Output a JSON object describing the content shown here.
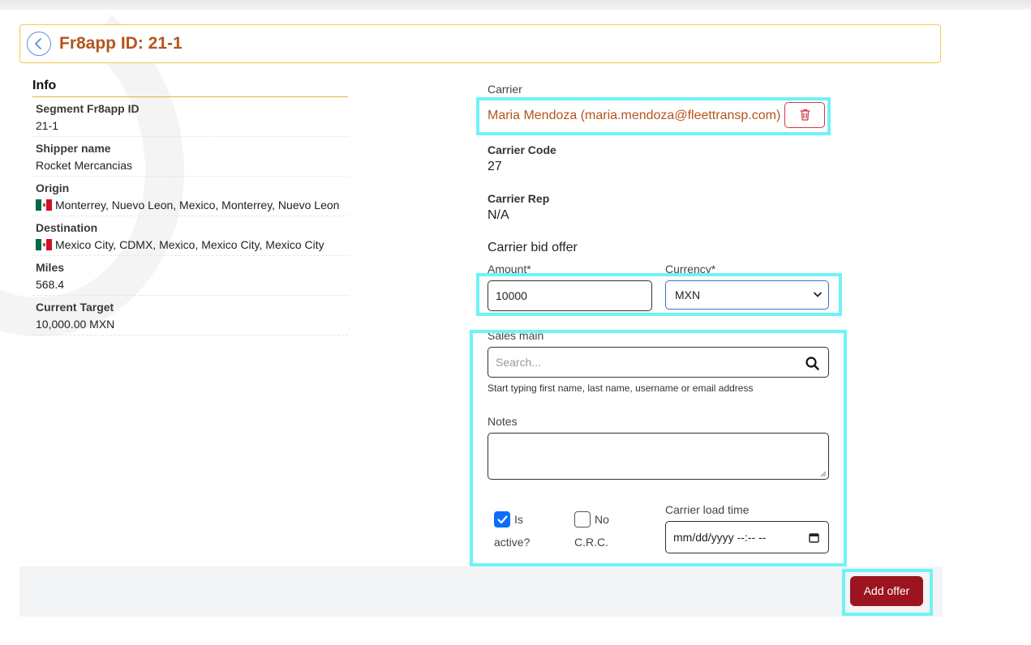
{
  "header": {
    "title": "Fr8app ID: 21-1"
  },
  "info": {
    "title": "Info",
    "rows": [
      {
        "label": "Segment Fr8app ID",
        "value": "21-1"
      },
      {
        "label": "Shipper name",
        "value": "Rocket Mercancias"
      },
      {
        "label": "Origin",
        "value": "Monterrey, Nuevo Leon, Mexico, Monterrey, Nuevo Leon"
      },
      {
        "label": "Destination",
        "value": "Mexico City, CDMX, Mexico, Mexico City, Mexico City"
      },
      {
        "label": "Miles",
        "value": "568.4"
      },
      {
        "label": "Current Target",
        "value": "10,000.00 MXN"
      }
    ]
  },
  "carrier": {
    "label": "Carrier",
    "name": "Maria Mendoza (maria.mendoza@fleettransp.com)",
    "code_label": "Carrier Code",
    "code": "27",
    "rep_label": "Carrier Rep",
    "rep": "N/A"
  },
  "bid": {
    "title": "Carrier bid offer",
    "amount_label": "Amount*",
    "amount_value": "10000",
    "currency_label": "Currency*",
    "currency_value": "MXN"
  },
  "sales": {
    "label": "Sales main",
    "search_placeholder": "Search...",
    "help": "Start typing first name, last name, username or email address"
  },
  "notes": {
    "label": "Notes",
    "value": ""
  },
  "checkboxes": {
    "is_active_line1": "Is",
    "is_active_line2": "active?",
    "no_crc_line1": "No",
    "no_crc_line2": "C.R.C."
  },
  "load_time": {
    "label": "Carrier load time",
    "value": "mm/dd/yyyy --:-- --"
  },
  "footer": {
    "add_offer": "Add offer"
  },
  "colors": {
    "accent": "#b5541c",
    "primary_button": "#9c1420",
    "highlight": "#6ff3f7"
  }
}
